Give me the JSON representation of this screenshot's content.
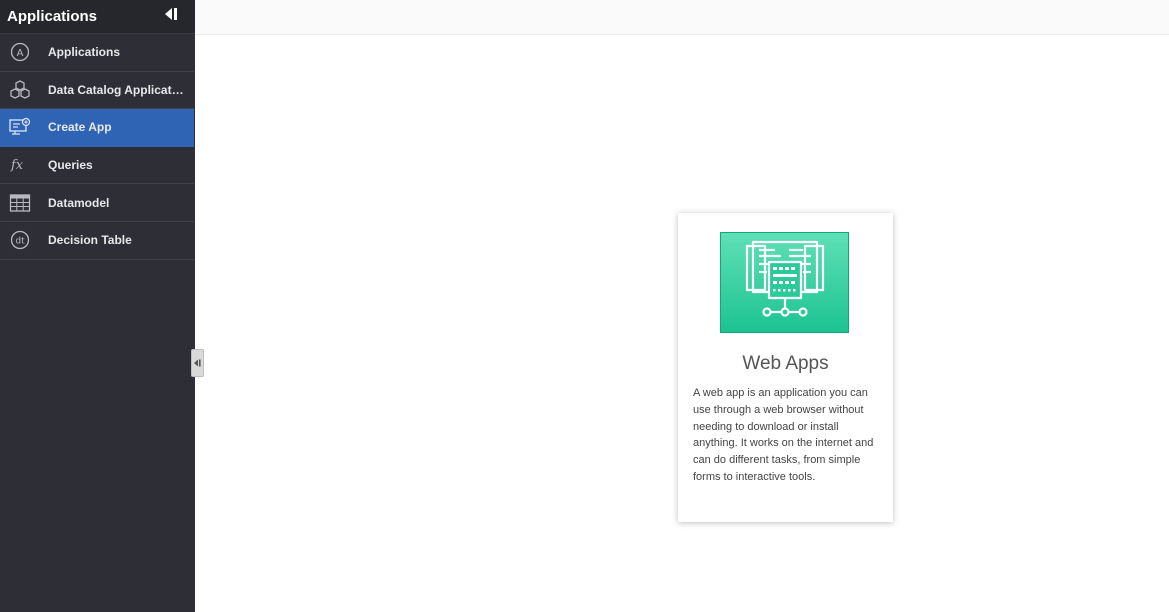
{
  "sidebar": {
    "title": "Applications",
    "items": [
      {
        "label": "Applications",
        "icon": "applications-icon"
      },
      {
        "label": "Data Catalog Applications",
        "icon": "data-catalog-icon"
      },
      {
        "label": "Create App",
        "icon": "create-app-icon",
        "active": true
      },
      {
        "label": "Queries",
        "icon": "function-icon"
      },
      {
        "label": "Datamodel",
        "icon": "table-grid-icon"
      },
      {
        "label": "Decision Table",
        "icon": "decision-table-icon"
      }
    ]
  },
  "card": {
    "title": "Web Apps",
    "description": "A web app is an application you can use through a web browser without needing to download or install anything. It works on the internet and can do different tasks, from simple forms to interactive tools.",
    "icon": "web-apps-icon"
  },
  "colors": {
    "sidebar_bg": "#2d2e36",
    "active_item": "#2f63b3",
    "card_image_top": "#5fe0b5",
    "card_image_bottom": "#1dc392"
  }
}
